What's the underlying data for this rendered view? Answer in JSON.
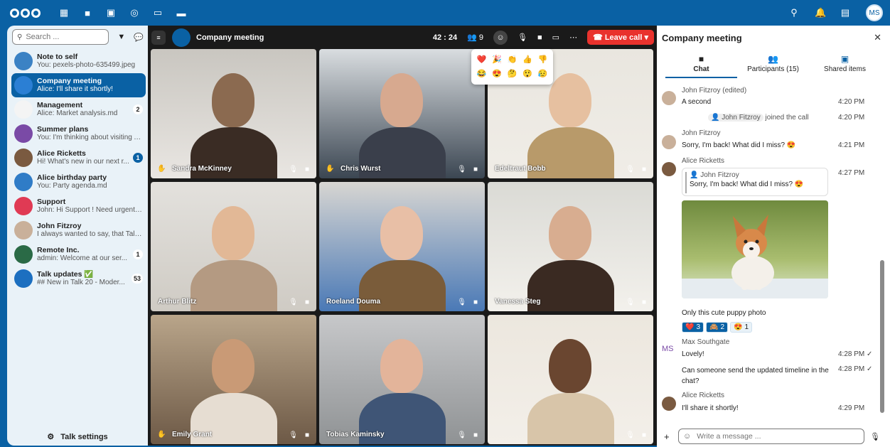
{
  "sidebar": {
    "search_placeholder": "Search ...",
    "conversations": [
      {
        "name": "Note to self",
        "last": "You: pexels-photo-635499.jpeg",
        "badge": "",
        "color": "#3b82c4"
      },
      {
        "name": "Company meeting",
        "last": "Alice: I'll share it shortly!",
        "badge": "",
        "color": "#2b7fd4",
        "active": true
      },
      {
        "name": "Management",
        "last": "Alice: Market analysis.md",
        "badge": "2",
        "color": "#f4f4f4"
      },
      {
        "name": "Summer plans",
        "last": "You: I'm thinking about visiting A...",
        "badge": "",
        "color": "#7a4aa6"
      },
      {
        "name": "Alice Ricketts",
        "last": "Hi! What's new in our next r...",
        "badge": "1",
        "color": "#7a5a40"
      },
      {
        "name": "Alice birthday party",
        "last": "You: Party agenda.md",
        "badge": "",
        "color": "#2f7cc7"
      },
      {
        "name": "Support",
        "last": "John: Hi Support ! Need urgent h...",
        "badge": "",
        "color": "#e03a54"
      },
      {
        "name": "John Fitzroy",
        "last": "I always wanted to say, that Talk ...",
        "badge": "",
        "color": "#c9b09a"
      },
      {
        "name": "Remote Inc.",
        "last": "admin: Welcome at our ser...",
        "badge": "1",
        "color": "#2a6a46"
      },
      {
        "name": "Talk updates ✅",
        "last": "## New in Talk 20 - Moder...",
        "badge": "53",
        "color": "#1c6fc0"
      }
    ],
    "settings_label": "Talk settings"
  },
  "call": {
    "title": "Company meeting",
    "timer": "42 : 24",
    "participants_count": "9",
    "leave_label": "Leave call",
    "tiles": [
      {
        "name": "Sandra McKinney",
        "hand": true
      },
      {
        "name": "Chris Wurst",
        "hand": true
      },
      {
        "name": "Edeltraut Bobb",
        "hand": false
      },
      {
        "name": "Arthur Blitz",
        "hand": false
      },
      {
        "name": "Roeland Douma",
        "hand": false
      },
      {
        "name": "Vanessa Steg",
        "hand": false
      },
      {
        "name": "Emily Grant",
        "hand": true
      },
      {
        "name": "Tobias Kaminsky",
        "hand": false
      },
      {
        "name": "",
        "hand": false
      }
    ],
    "emojis": [
      "❤️",
      "🎉",
      "👏",
      "👍",
      "👎",
      "😂",
      "😍",
      "🤔",
      "😲",
      "😥"
    ]
  },
  "chat": {
    "title": "Company meeting",
    "tabs": [
      "Chat",
      "Participants (15)",
      "Shared items"
    ],
    "messages": {
      "m1_author": "John Fitzroy (edited)",
      "m1_text": "A second",
      "m1_time": "4:20 PM",
      "sys_name": "John Fitzroy",
      "sys_text": "joined the call",
      "sys_time": "4:20 PM",
      "m2_author": "John Fitzroy",
      "m2_text": "Sorry, I'm back! What did I miss? 😍",
      "m2_time": "4:21 PM",
      "m3_author": "Alice Ricketts",
      "m3_time": "4:27 PM",
      "quote_author": "John Fitzroy",
      "quote_text": "Sorry, I'm back! What did I miss? 😍",
      "m3_caption": "Only this cute puppy photo",
      "reactions": [
        {
          "emoji": "❤️",
          "count": "3",
          "own": true
        },
        {
          "emoji": "🙈",
          "count": "2",
          "own": true
        },
        {
          "emoji": "😍",
          "count": "1",
          "own": false
        }
      ],
      "m4_author": "Max Southgate",
      "m4_initials": "MS",
      "m4_text": "Lovely!",
      "m4_time": "4:28 PM ✓",
      "m5_text_1": "Can someone send the updated timeline in the",
      "m5_text_2": "chat?",
      "m5_time": "4:28 PM ✓",
      "m6_author": "Alice Ricketts",
      "m6_text": "I'll share it shortly!",
      "m6_time": "4:29 PM"
    },
    "composer_placeholder": "Write a message ..."
  },
  "user_initials": "MS"
}
